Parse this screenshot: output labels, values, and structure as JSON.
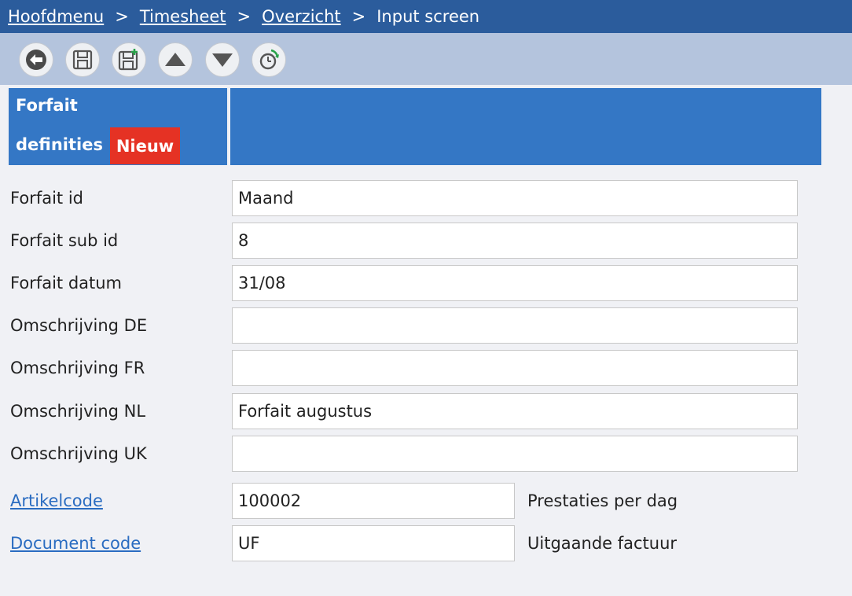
{
  "breadcrumb": {
    "items": [
      "Hoofdmenu",
      "Timesheet",
      "Overzicht"
    ],
    "current": "Input screen",
    "separator": ">"
  },
  "toolbar": {
    "buttons": [
      "back-icon",
      "save-icon",
      "save-new-icon",
      "up-icon",
      "down-icon",
      "history-icon"
    ]
  },
  "header": {
    "title_line1": "Forfait",
    "title_line2": "definities",
    "badge": "Nieuw"
  },
  "form": {
    "fields": [
      {
        "label": "Forfait id",
        "value": "Maand"
      },
      {
        "label": "Forfait sub id",
        "value": "8"
      },
      {
        "label": "Forfait datum",
        "value": "31/08"
      },
      {
        "label": "Omschrijving DE",
        "value": ""
      },
      {
        "label": "Omschrijving FR",
        "value": ""
      },
      {
        "label": "Omschrijving NL",
        "value": "Forfait augustus"
      },
      {
        "label": "Omschrijving UK",
        "value": ""
      }
    ],
    "lookups": [
      {
        "label": "Artikelcode",
        "value": "100002",
        "description": "Prestaties per dag"
      },
      {
        "label": "Document code",
        "value": "UF",
        "description": "Uitgaande factuur"
      }
    ]
  },
  "colors": {
    "breadcrumb_bg": "#2b5c9c",
    "toolbar_bg": "#b4c4dd",
    "header_bg": "#3477c5",
    "badge_bg": "#e53224",
    "link": "#2a6cc1"
  }
}
